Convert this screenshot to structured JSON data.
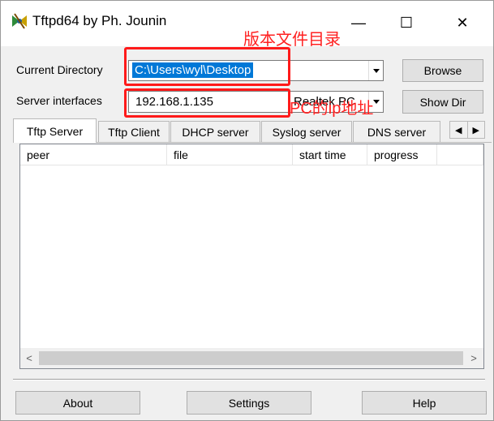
{
  "window": {
    "title": "Tftpd64 by Ph. Jounin",
    "icon": "tftpd-app-icon",
    "minimize_glyph": "—",
    "maximize_glyph": "☐",
    "close_glyph": "✕"
  },
  "current_directory": {
    "label": "Current Directory",
    "value": "C:\\Users\\wyl\\Desktop"
  },
  "server_interfaces": {
    "label": "Server interfaces",
    "ip": "192.168.1.135",
    "adapter": "Realtek PC"
  },
  "buttons": {
    "browse": "Browse",
    "show_dir": "Show Dir"
  },
  "tabs": [
    {
      "label": "Tftp Server",
      "active": true
    },
    {
      "label": "Tftp Client"
    },
    {
      "label": "DHCP server"
    },
    {
      "label": "Syslog server"
    },
    {
      "label": "DNS server"
    }
  ],
  "table": {
    "columns": [
      "peer",
      "file",
      "start time",
      "progress"
    ]
  },
  "bottom": {
    "about": "About",
    "settings": "Settings",
    "help": "Help"
  },
  "annotations": {
    "dir_note": "版本文件目录",
    "ip_note": "PC的ip地址",
    "color": "#ff1a1a"
  }
}
